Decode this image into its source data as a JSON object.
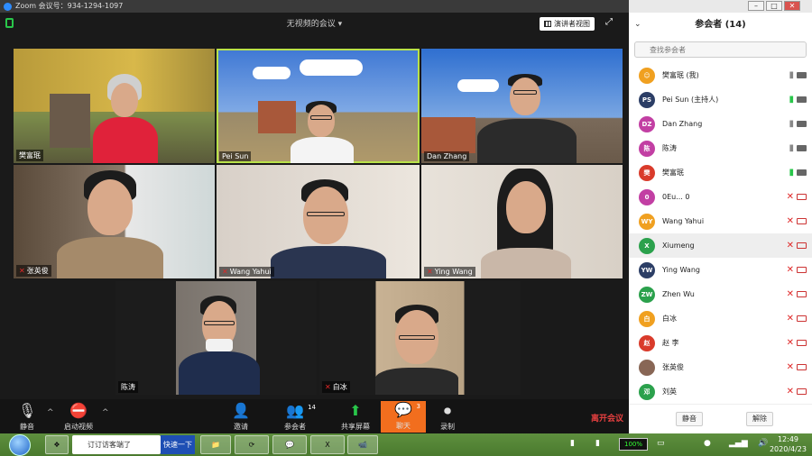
{
  "window": {
    "title": "Zoom 会议号：934-1294-1097",
    "meeting_topic": "无视频的会议 ▾",
    "view_button": "演讲者视图"
  },
  "tiles": [
    {
      "name": "樊富珉",
      "muted": false,
      "bg": "#8a7a3a"
    },
    {
      "name": "Pei Sun",
      "muted": false,
      "active": true,
      "bg": "#4a7ec9"
    },
    {
      "name": "Dan Zhang",
      "muted": false,
      "bg": "#4a82c9"
    },
    {
      "name": "张英俊",
      "muted": true,
      "bg": "#6a5a48"
    },
    {
      "name": "Wang Yahui",
      "muted": true,
      "bg": "#c9c1b5"
    },
    {
      "name": "Ying Wang",
      "muted": true,
      "bg": "#d8d2c8"
    },
    {
      "name": "陈涛",
      "muted": false,
      "bg": "#6a6360"
    },
    {
      "name": "白冰",
      "muted": true,
      "bg": "#b8a58a"
    }
  ],
  "toolbar": {
    "mute": "静音",
    "video": "启动视频",
    "invite": "邀请",
    "participants": "参会者",
    "participants_count": "14",
    "share": "共享屏幕",
    "chat": "聊天",
    "chat_count": "3",
    "record": "录制",
    "end": "离开会议"
  },
  "panel": {
    "title": "参会者 (14)",
    "search_placeholder": "查找参会者",
    "mute_all": "静音",
    "unmute_all": "解除",
    "participants": [
      {
        "initials": "☺",
        "name": "樊富珉 (我)",
        "color": "#f0a020",
        "mic": "on",
        "video": "on"
      },
      {
        "initials": "PS",
        "name": "Pei Sun (主持人)",
        "color": "#2c3e66",
        "mic": "talk",
        "video": "on"
      },
      {
        "initials": "DZ",
        "name": "Dan Zhang",
        "color": "#c23fa3",
        "mic": "on",
        "video": "on"
      },
      {
        "initials": "陈",
        "name": "陈涛",
        "color": "#c23fa3",
        "mic": "on",
        "video": "on"
      },
      {
        "initials": "樊",
        "name": "樊富珉",
        "color": "#d93b2b",
        "mic": "talk",
        "video": "on"
      },
      {
        "initials": "0",
        "name": "0Eu... 0",
        "color": "#c23fa3",
        "mic": "off",
        "video": "off"
      },
      {
        "initials": "WY",
        "name": "Wang Yahui",
        "color": "#f0a020",
        "mic": "off",
        "video": "off"
      },
      {
        "initials": "X",
        "name": "Xiumeng",
        "color": "#2ba14c",
        "mic": "off",
        "video": "off"
      },
      {
        "initials": "YW",
        "name": "Ying Wang",
        "color": "#2c3e66",
        "mic": "off",
        "video": "off"
      },
      {
        "initials": "ZW",
        "name": "Zhen Wu",
        "color": "#2ba14c",
        "mic": "off",
        "video": "off"
      },
      {
        "initials": "白",
        "name": "白冰",
        "color": "#f0a020",
        "mic": "off",
        "video": "off"
      },
      {
        "initials": "赵",
        "name": "赵 李",
        "color": "#d93b2b",
        "mic": "off",
        "video": "off"
      },
      {
        "initials": "",
        "name": "张英俊",
        "color": "#886655",
        "mic": "off",
        "video": "off"
      },
      {
        "initials": "邓",
        "name": "刘英",
        "color": "#2ba14c",
        "mic": "off",
        "video": "off"
      }
    ]
  },
  "taskbar": {
    "browser_tab": "订订访客端了",
    "browser_badge": "快速一下",
    "battery": "100%",
    "time": "12:49",
    "date": "2020/4/23"
  },
  "colors": {
    "accent_chat": "#f26e1e",
    "active_speaker": "#b9e24a",
    "end_meeting": "#e84040",
    "muted": "#e02828",
    "talking": "#29c64a"
  }
}
